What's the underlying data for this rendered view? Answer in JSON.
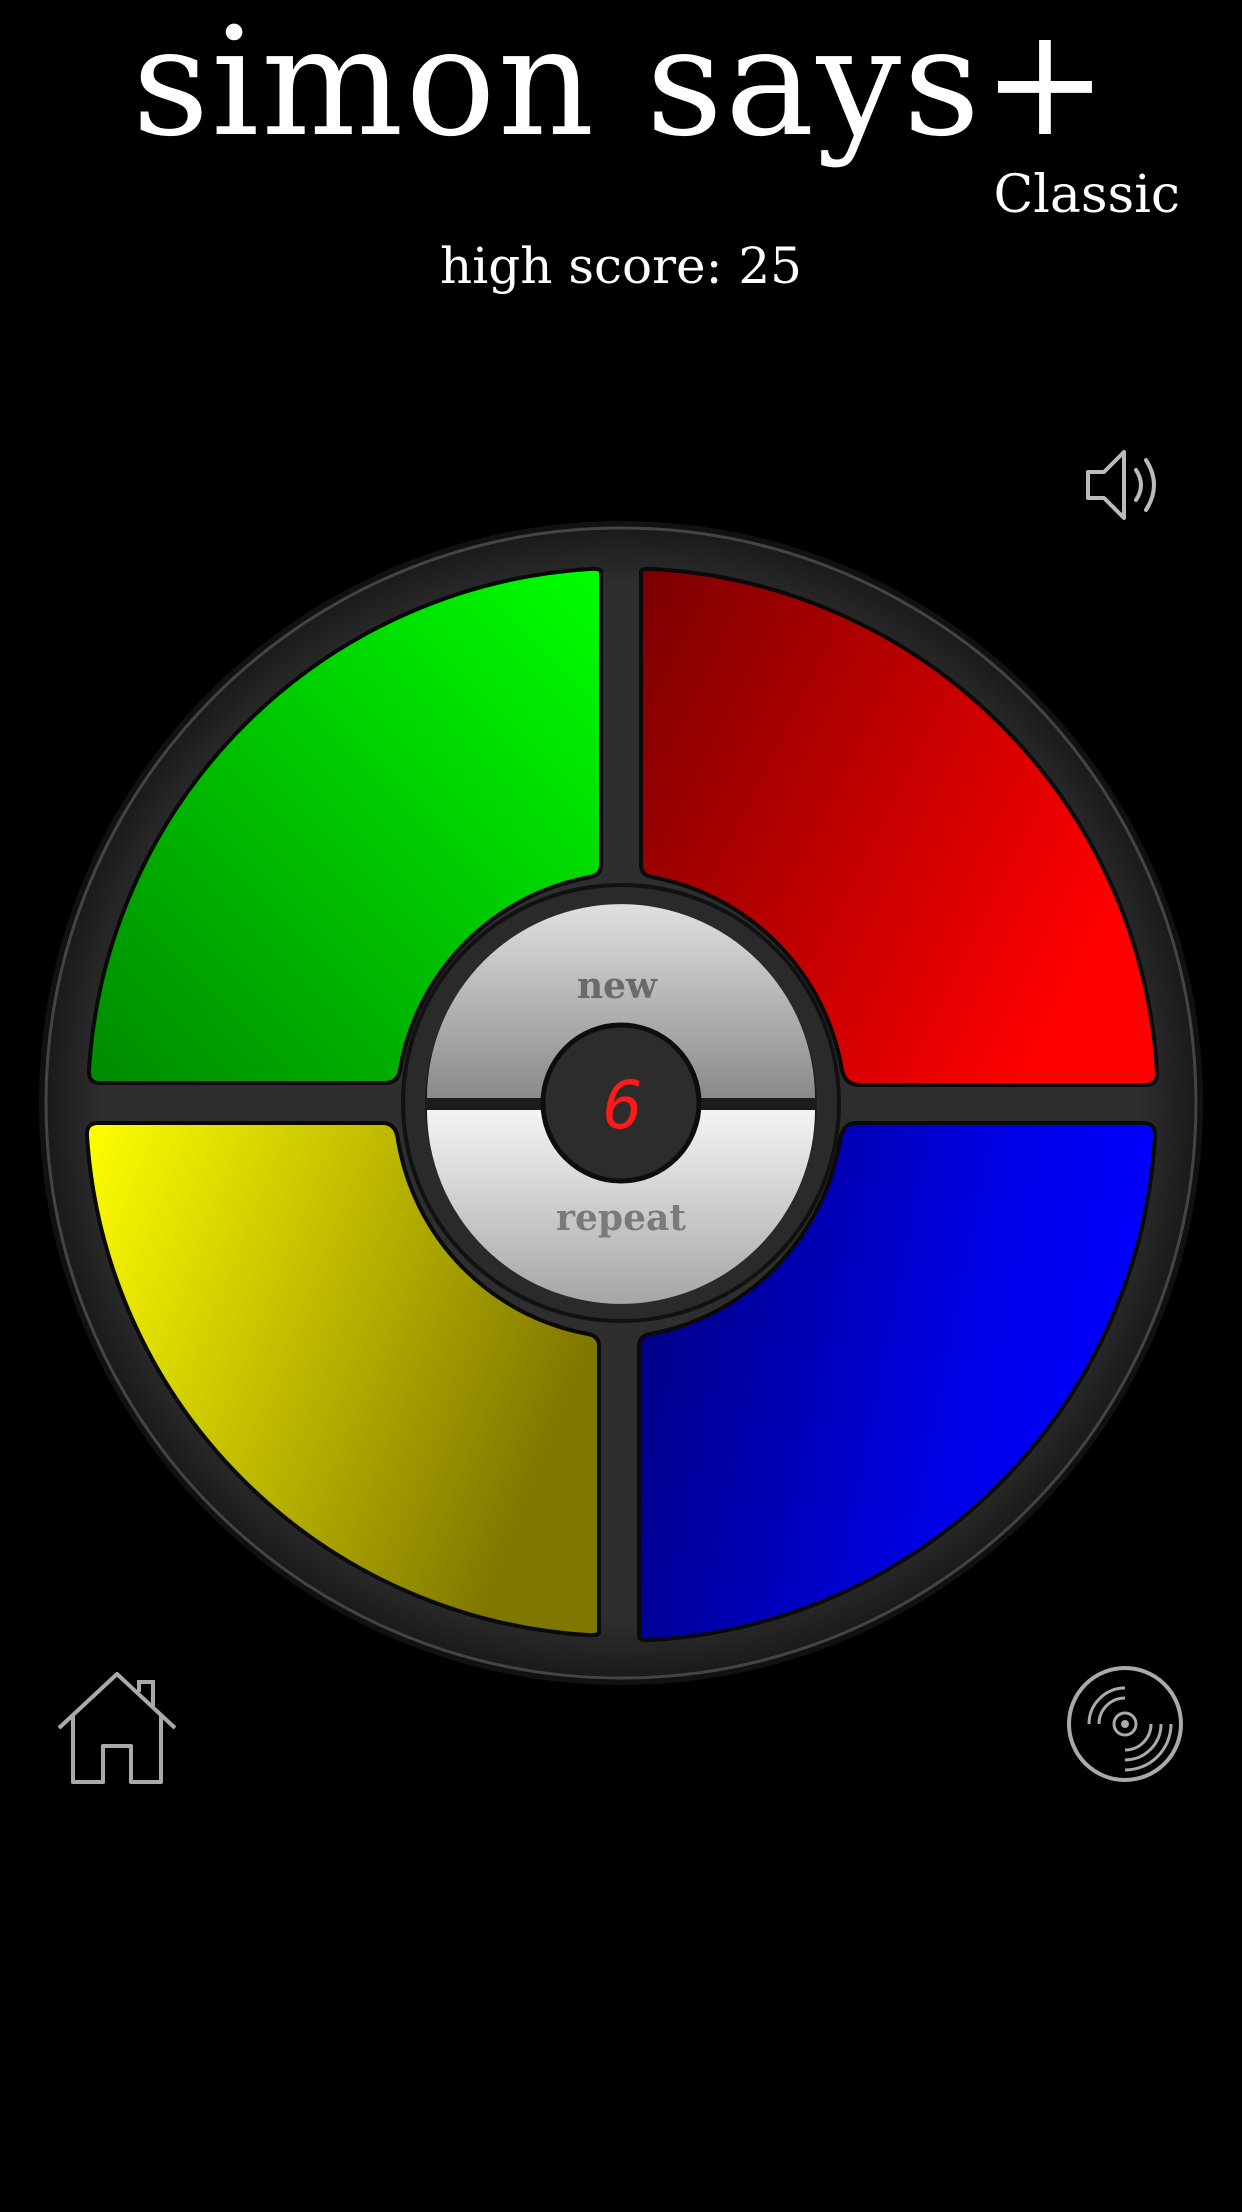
{
  "header": {
    "title": "simon says+",
    "mode": "Classic",
    "high_score_text": "high score: 25"
  },
  "board": {
    "new_label": "new",
    "repeat_label": "repeat",
    "counter": "6",
    "colors": {
      "green": "#00cc00",
      "red": "#e00000",
      "yellow": "#e5e000",
      "blue": "#0000d8",
      "counter_digit": "#ff1a1a"
    }
  },
  "icons": {
    "sound": "speaker-icon",
    "home": "home-icon",
    "music": "disc-icon"
  }
}
